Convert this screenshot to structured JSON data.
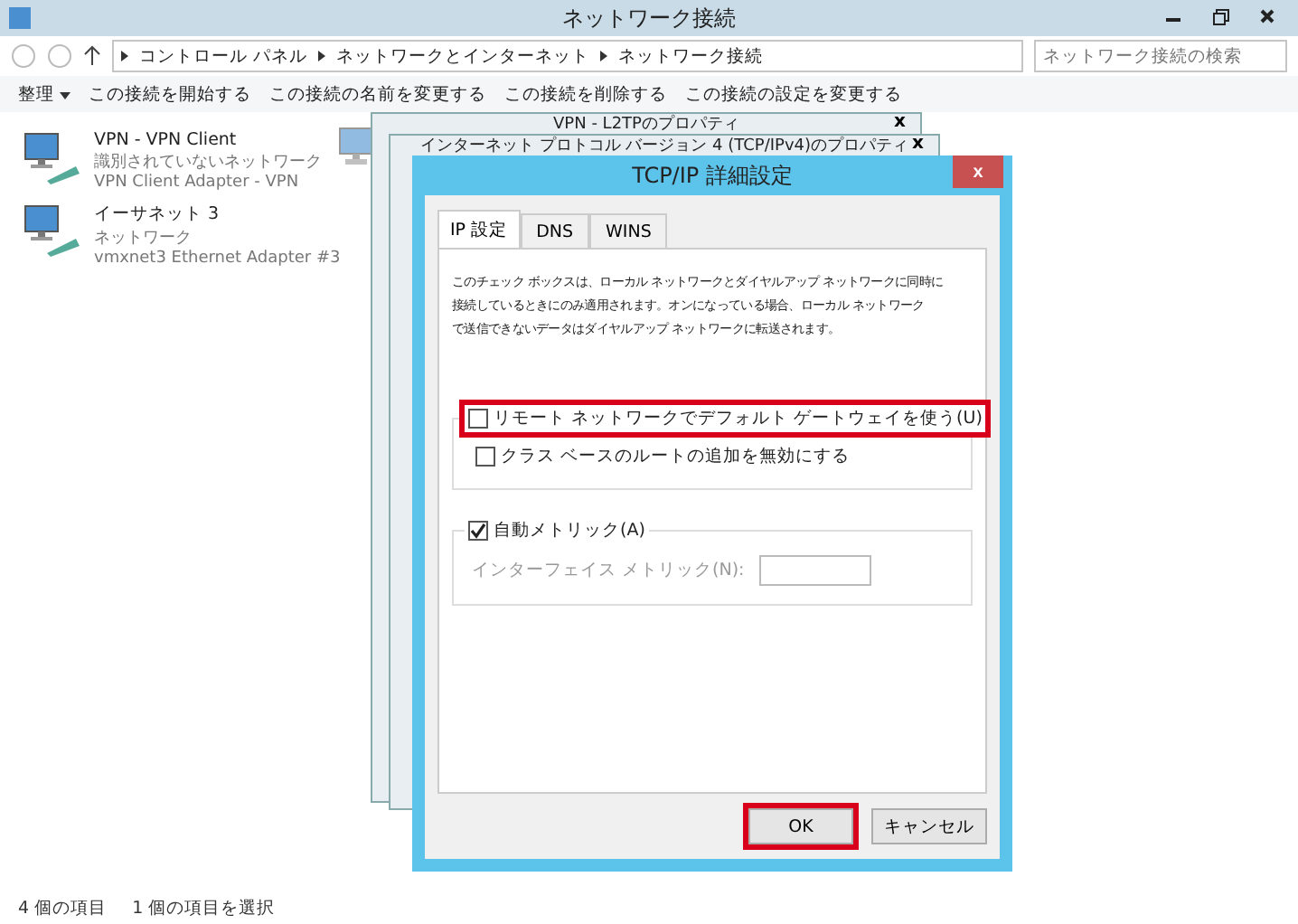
{
  "window": {
    "title": "ネットワーク接続"
  },
  "address": {
    "crumbs": [
      "コントロール パネル",
      "ネットワークとインターネット",
      "ネットワーク接続"
    ],
    "search_placeholder": "ネットワーク接続の検索"
  },
  "toolbar": {
    "organize": "整理",
    "actions": [
      "この接続を開始する",
      "この接続の名前を変更する",
      "この接続を削除する",
      "この接続の設定を変更する"
    ]
  },
  "connections": [
    {
      "name": "VPN - VPN Client",
      "status": "識別されていないネットワーク",
      "adapter": "VPN Client Adapter - VPN"
    },
    {
      "name": "イーサネット 3",
      "status": "ネットワーク",
      "adapter": "vmxnet3 Ethernet Adapter #3"
    }
  ],
  "back_windows": [
    {
      "title": "VPN - L2TPのプロパティ",
      "close": "x"
    },
    {
      "title": "インターネット プロトコル バージョン 4 (TCP/IPv4)のプロパティ",
      "close": "x"
    }
  ],
  "dialog": {
    "title": "TCP/IP 詳細設定",
    "close": "x",
    "tabs": [
      {
        "label": "IP 設定",
        "selected": true
      },
      {
        "label": "DNS",
        "selected": false
      },
      {
        "label": "WINS",
        "selected": false
      }
    ],
    "description_lines": [
      "このチェック ボックスは、ローカル ネットワークとダイヤルアップ ネットワークに同時に",
      "接続しているときにのみ適用されます。オンになっている場合、ローカル ネットワーク",
      "で送信できないデータはダイヤルアップ ネットワークに転送されます。"
    ],
    "gateway_group": {
      "checkbox": {
        "label": "リモート ネットワークでデフォルト ゲートウェイを使う(U)",
        "checked": false,
        "highlighted": true
      },
      "options": [
        {
          "label": "クラス ベースのルートの追加を無効にする",
          "checked": false
        }
      ]
    },
    "metric_group": {
      "checkbox": {
        "label": "自動メトリック(A)",
        "checked": true,
        "highlighted": false
      },
      "field_label": "インターフェイス メトリック(N):",
      "field_disabled": true
    },
    "buttons": [
      {
        "label": "OK",
        "highlighted": true
      },
      {
        "label": "キャンセル",
        "highlighted": false
      }
    ]
  },
  "status_bar": {
    "items": [
      "4 個の項目",
      "1 個の項目を選択"
    ]
  }
}
